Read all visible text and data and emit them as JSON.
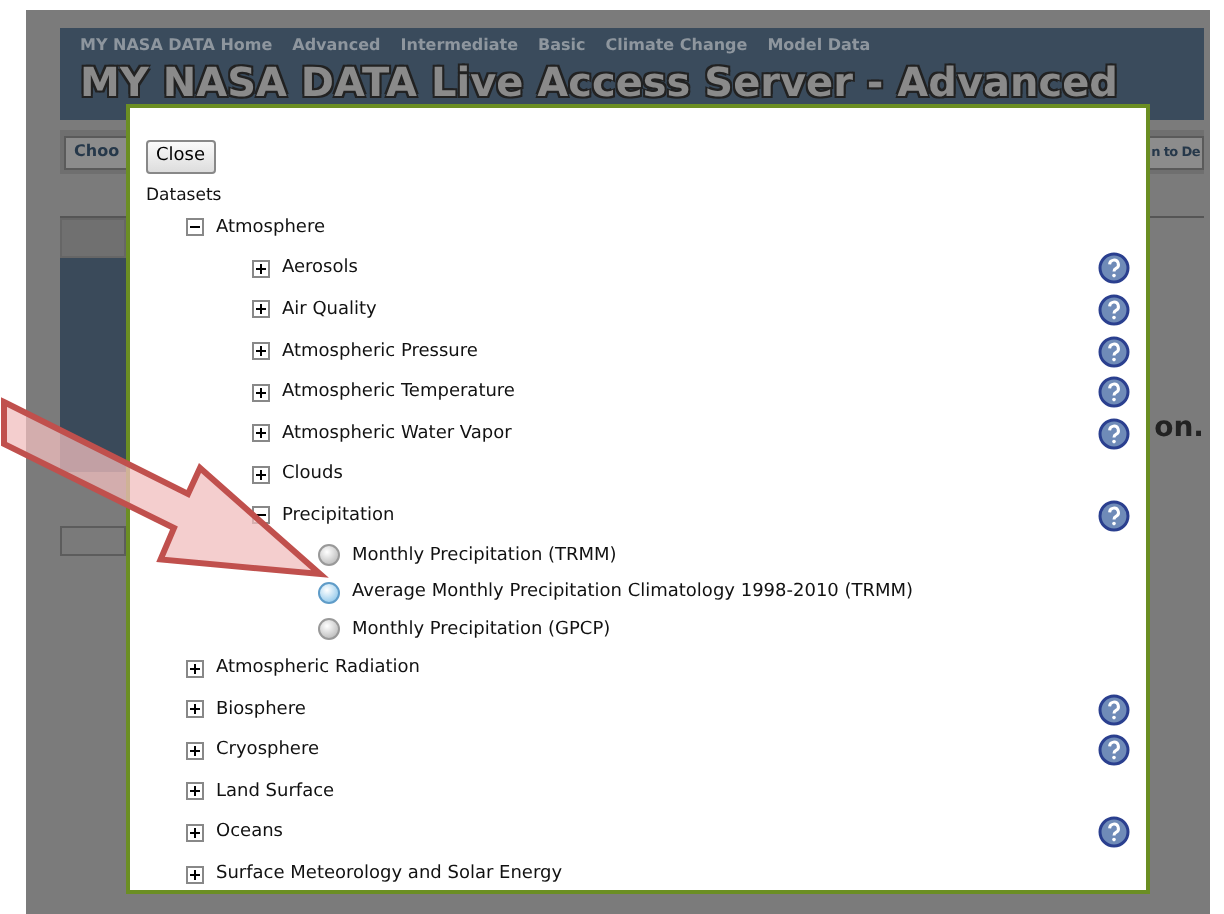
{
  "nav": {
    "links": [
      "MY NASA DATA Home",
      "Advanced",
      "Intermediate",
      "Basic",
      "Climate Change",
      "Model Data"
    ]
  },
  "title": "MY NASA DATA Live Access Server - Advanced",
  "toolbar": {
    "left_text": "Choo",
    "right_text": "n to De"
  },
  "side_text": "on.",
  "dialog": {
    "close_button": "Close",
    "heading": "Datasets",
    "tree": [
      {
        "label": "Atmosphere",
        "expanded": true,
        "help": false,
        "children": [
          {
            "label": "Aerosols",
            "expanded": false,
            "help": true
          },
          {
            "label": "Air Quality",
            "expanded": false,
            "help": true
          },
          {
            "label": "Atmospheric Pressure",
            "expanded": false,
            "help": true
          },
          {
            "label": "Atmospheric Temperature",
            "expanded": false,
            "help": true
          },
          {
            "label": "Atmospheric Water Vapor",
            "expanded": false,
            "help": true
          },
          {
            "label": "Clouds",
            "expanded": false,
            "help": false
          },
          {
            "label": "Precipitation",
            "expanded": true,
            "help": true,
            "children": [
              {
                "kind": "radio",
                "label": "Monthly Precipitation (TRMM)",
                "selected": false
              },
              {
                "kind": "radio",
                "label": "Average Monthly Precipitation Climatology 1998-2010 (TRMM)",
                "selected": true
              },
              {
                "kind": "radio",
                "label": "Monthly Precipitation (GPCP)",
                "selected": false
              }
            ]
          }
        ]
      },
      {
        "label": "Atmospheric Radiation",
        "expanded": false,
        "help": false
      },
      {
        "label": "Biosphere",
        "expanded": false,
        "help": true
      },
      {
        "label": "Cryosphere",
        "expanded": false,
        "help": true
      },
      {
        "label": "Land Surface",
        "expanded": false,
        "help": false
      },
      {
        "label": "Oceans",
        "expanded": false,
        "help": true
      },
      {
        "label": "Surface Meteorology and Solar Energy",
        "expanded": false,
        "help": false
      }
    ]
  }
}
